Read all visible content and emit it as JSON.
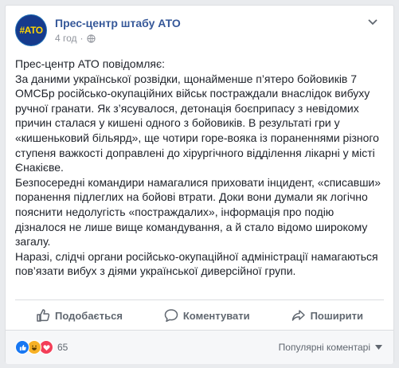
{
  "post": {
    "author": "Прес-центр штабу АТО",
    "avatar_text": "#АТО",
    "time": "4 год",
    "visibility_icon": "globe-icon",
    "paragraphs": [
      "Прес-центр АТО повідомляє:",
      "За даними української розвідки, щонайменше п’ятеро бойовиків 7 ОМСБр російсько-окупаційних військ постраждали внаслідок вибуху ручної гранати. Як з’ясувалося, детонація боєприпасу з невідомих причин сталася у кишені одного з бойовиків. В результаті гри у «кишеньковий більярд», ще чотири горе-вояка із пораненнями різного ступеня важкості доправлені до хірургічного відділення лікарні у місті Єнакієве.",
      "Безпосередні командири намагалися приховати інцидент, «списавши» поранення підлеглих на бойові втрати. Доки вони думали як логічно пояснити недолугість «постраждалих», інформація про подію дізналося не лише вище командування, а й стало відомо широкому загалу.",
      "Наразі, слідчі органи російсько-окупаційної адміністрації намагаються пов’язати вибух з діями української диверсійної групи."
    ]
  },
  "actions": {
    "like": "Подобається",
    "comment": "Коментувати",
    "share": "Поширити"
  },
  "footer": {
    "reaction_count": "65",
    "comments_filter": "Популярні коментарі"
  },
  "colors": {
    "link": "#365899",
    "text": "#1d2129",
    "muted": "#606770",
    "like_blue": "#1877f2",
    "haha_yellow": "#f7b125",
    "love_red": "#f33e58"
  }
}
